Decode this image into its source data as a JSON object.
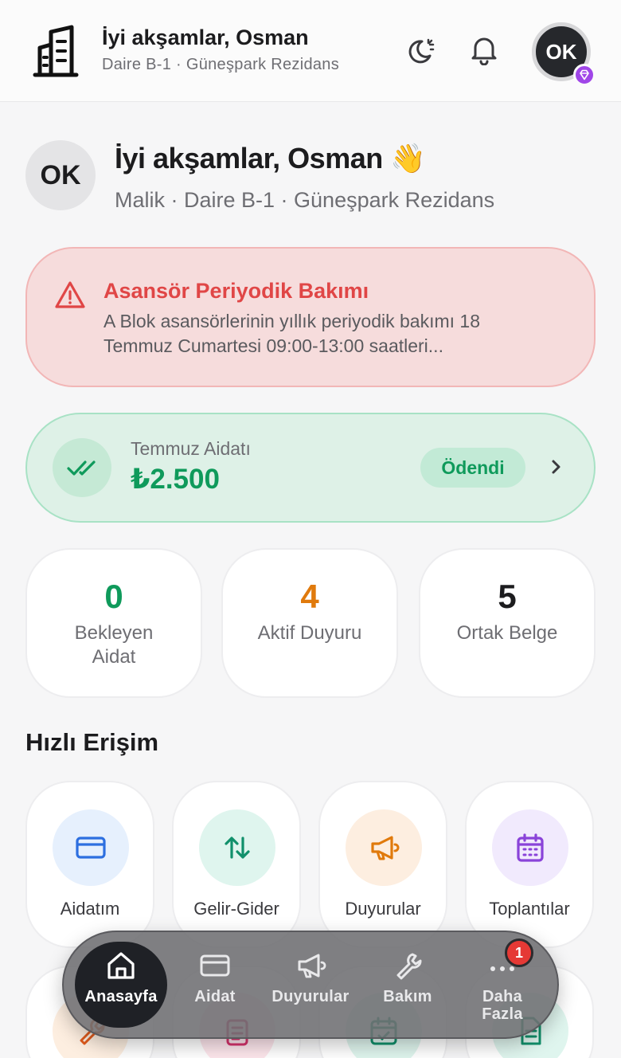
{
  "header": {
    "title": "İyi akşamlar, Osman",
    "subtitle": "Daire B-1 · Güneşpark Rezidans",
    "avatar_initials": "OK",
    "icons": [
      "building-icon",
      "theme-toggle-icon",
      "bell-icon",
      "gem-icon"
    ]
  },
  "greeting": {
    "avatar_initials": "OK",
    "title": "İyi akşamlar, Osman",
    "emoji": "👋",
    "subtitle": "Malik · Daire B-1 · Güneşpark Rezidans"
  },
  "alert": {
    "title": "Asansör Periyodik Bakımı",
    "text": "A Blok asansörlerinin yıllık periyodik bakımı 18 Temmuz Cumartesi 09:00-13:00 saatleri...",
    "color": "#e04646"
  },
  "dues": {
    "label": "Temmuz Aidatı",
    "amount": "₺2.500",
    "status": "Ödendi",
    "color": "#0f9a5b"
  },
  "stats": [
    {
      "value": "0",
      "label": "Bekleyen Aidat",
      "color": "#0f9a5b"
    },
    {
      "value": "4",
      "label": "Aktif Duyuru",
      "color": "#e07a0c"
    },
    {
      "value": "5",
      "label": "Ortak Belge",
      "color": "#1c1c1e"
    }
  ],
  "quick_access": {
    "title": "Hızlı Erişim",
    "items": [
      {
        "label": "Aidatım",
        "icon": "card-icon",
        "bg": "#e6f0fd",
        "fg": "#2d6fe0"
      },
      {
        "label": "Gelir-Gider",
        "icon": "transfer-icon",
        "bg": "#dff5ee",
        "fg": "#11906b"
      },
      {
        "label": "Duyurular",
        "icon": "megaphone-icon",
        "bg": "#fdeee0",
        "fg": "#e07a0c"
      },
      {
        "label": "Toplantılar",
        "icon": "calendar-icon",
        "bg": "#f1eafd",
        "fg": "#8a43d9"
      }
    ]
  },
  "bottom_nav": {
    "items": [
      {
        "label": "Anasayfa",
        "icon": "home-icon",
        "active": true
      },
      {
        "label": "Aidat",
        "icon": "card-icon"
      },
      {
        "label": "Duyurular",
        "icon": "megaphone-icon"
      },
      {
        "label": "Bakım",
        "icon": "wrench-icon"
      },
      {
        "label": "Daha Fazla",
        "icon": "more-icon"
      }
    ],
    "badge": "1"
  }
}
